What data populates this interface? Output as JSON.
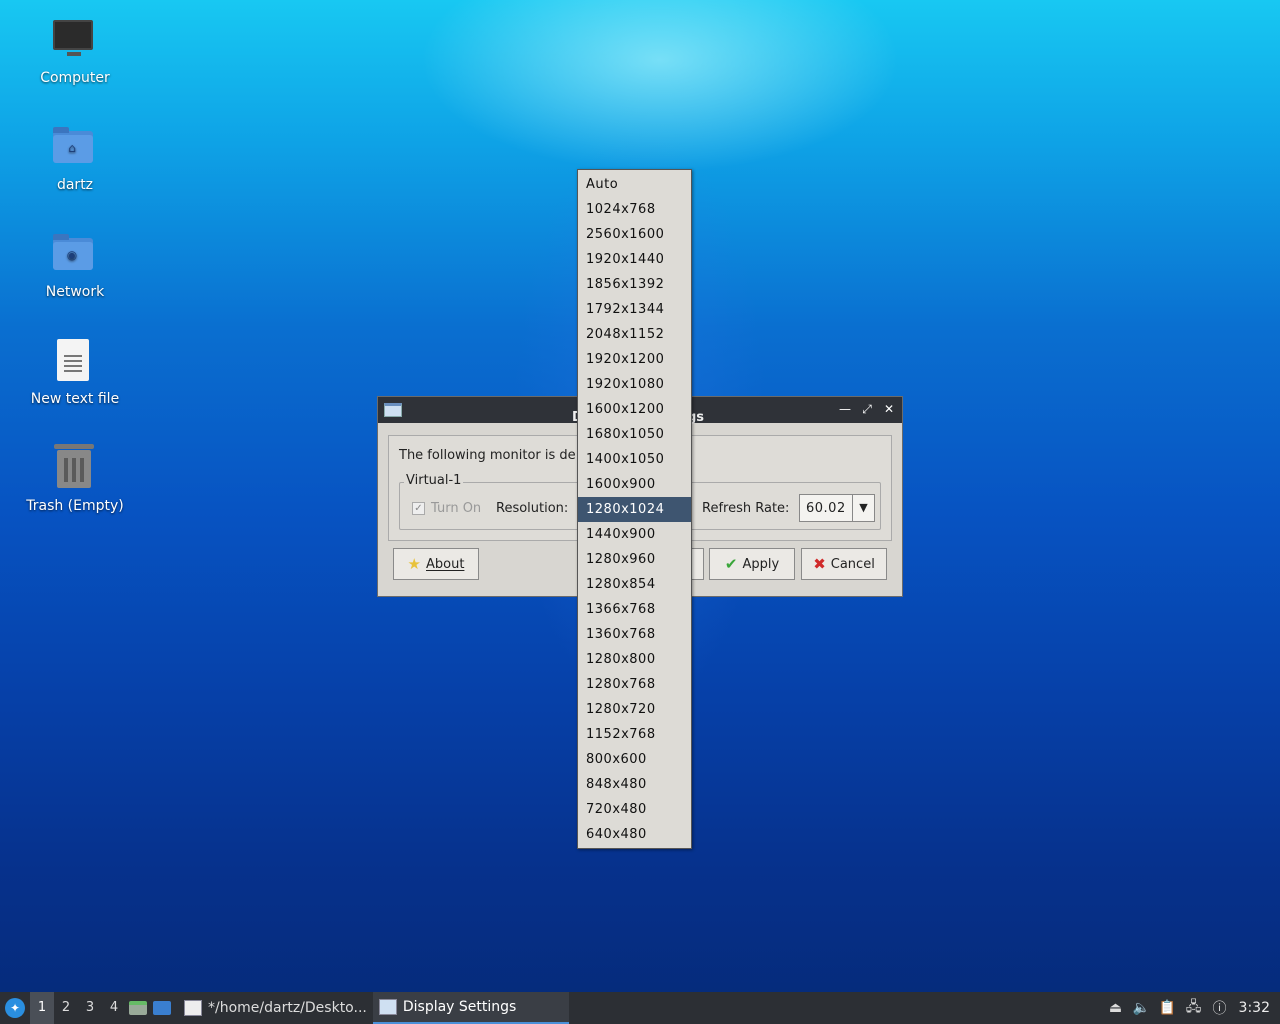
{
  "desktop": {
    "icons": [
      {
        "label": "Computer",
        "icon": "computer-icon"
      },
      {
        "label": "dartz",
        "icon": "home-folder-icon"
      },
      {
        "label": "Network",
        "icon": "network-folder-icon"
      },
      {
        "label": "New text file",
        "icon": "text-file-icon"
      },
      {
        "label": "Trash (Empty)",
        "icon": "trash-icon"
      }
    ]
  },
  "dialog": {
    "title_left": "D",
    "title_right": "gs",
    "message": "The following monitor is de",
    "monitor_name": "Virtual-1",
    "turn_on_label": "Turn On",
    "turn_on_checked": true,
    "resolution_label": "Resolution:",
    "refresh_rate_label": "Refresh Rate:",
    "refresh_rate_value": "60.02",
    "buttons": {
      "about": "About",
      "apply": "Apply",
      "cancel": "Cancel"
    }
  },
  "resolution_dropdown": {
    "selected": "1280x1024",
    "options": [
      "Auto",
      "1024x768",
      "2560x1600",
      "1920x1440",
      "1856x1392",
      "1792x1344",
      "2048x1152",
      "1920x1200",
      "1920x1080",
      "1600x1200",
      "1680x1050",
      "1400x1050",
      "1600x900",
      "1280x1024",
      "1440x900",
      "1280x960",
      "1280x854",
      "1366x768",
      "1360x768",
      "1280x800",
      "1280x768",
      "1280x720",
      "1152x768",
      "800x600",
      "848x480",
      "720x480",
      "640x480"
    ]
  },
  "taskbar": {
    "workspaces": [
      "1",
      "2",
      "3",
      "4"
    ],
    "active_workspace": "1",
    "tasks": [
      {
        "label": "*/home/dartz/Deskto...",
        "active": false
      },
      {
        "label": "Display Settings",
        "active": true
      }
    ],
    "clock": "3:32"
  }
}
